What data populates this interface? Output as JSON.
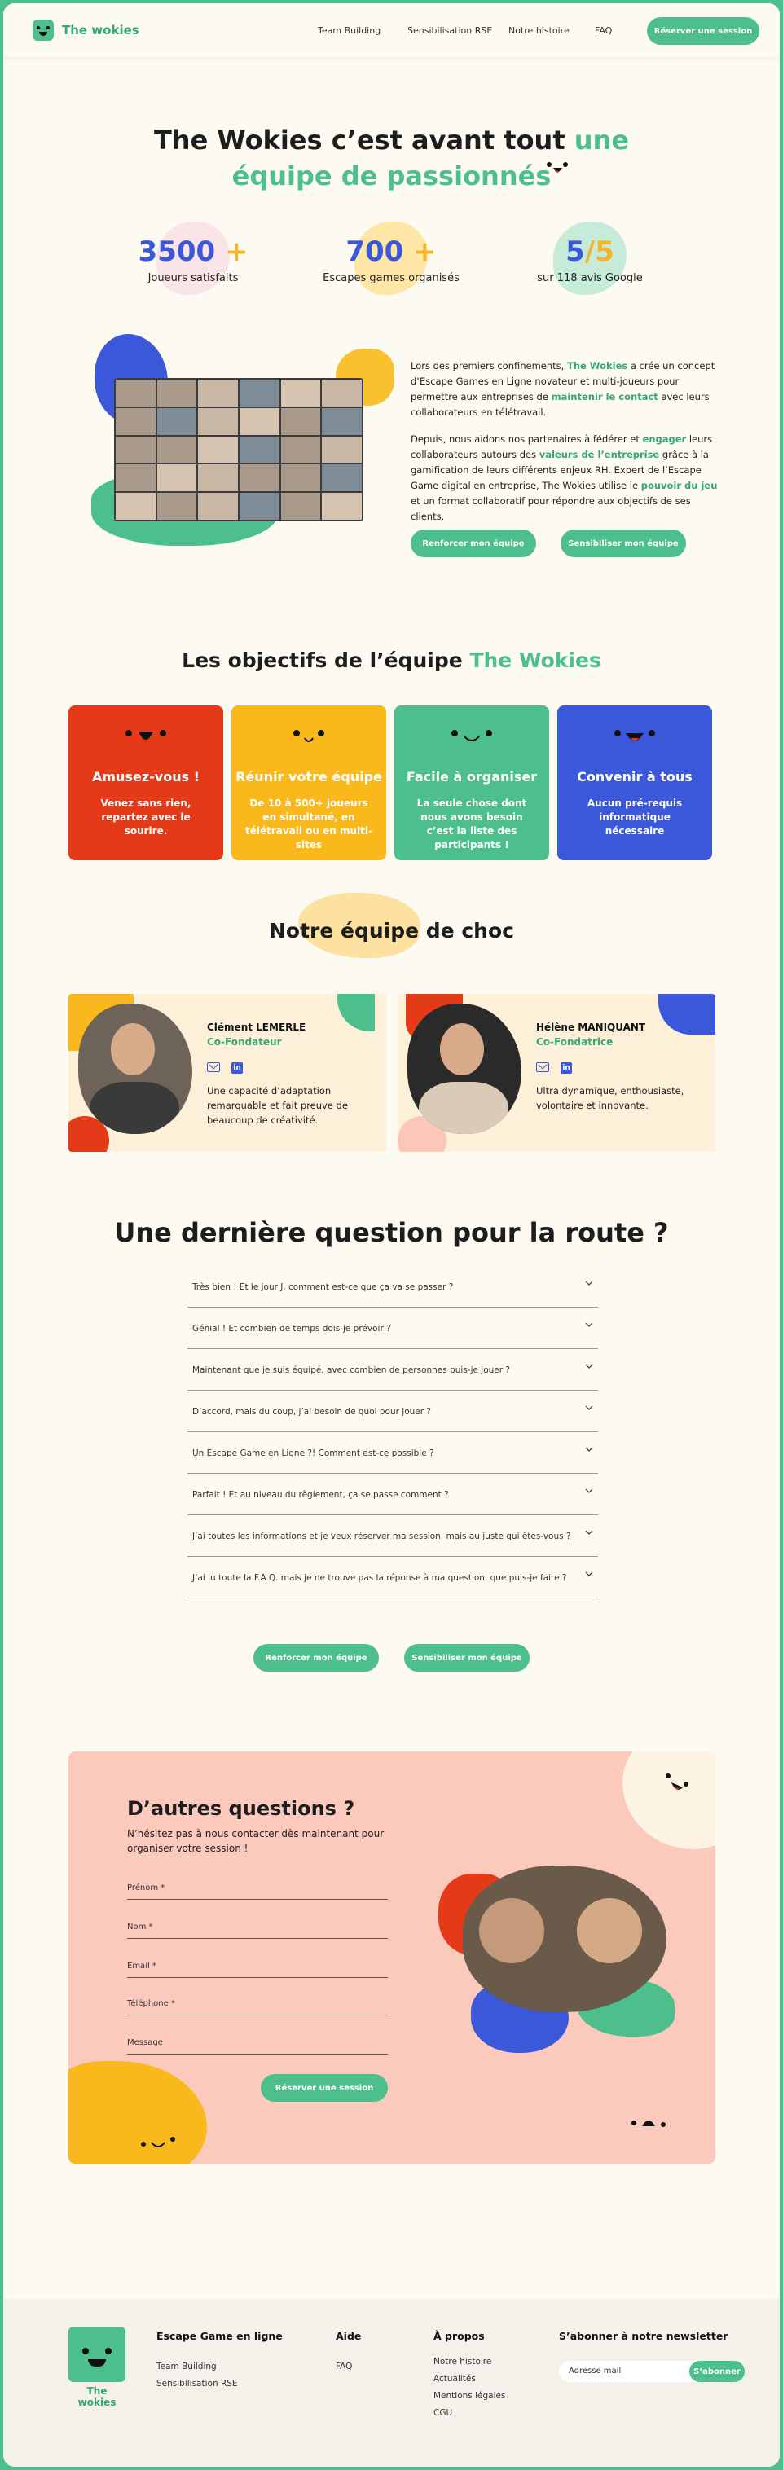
{
  "header": {
    "brand": "The wokies",
    "nav": [
      "Team Building",
      "Sensibilisation RSE",
      "Notre histoire",
      "FAQ"
    ],
    "cta": "Réserver une session"
  },
  "hero": {
    "title_part1": "The Wokies c’est avant tout",
    "title_accent1": "une",
    "title_accent2": "équipe de passionnés"
  },
  "stats": [
    {
      "value": "3500",
      "suffix": "+",
      "label": "Joueurs satisfaits"
    },
    {
      "value": "700",
      "suffix": "+",
      "label": "Escapes games organisés"
    },
    {
      "value": "5",
      "suffix": "/5",
      "label": "sur 118 avis Google"
    }
  ],
  "intro": {
    "p1_a": "Lors des premiers confinements,",
    "p1_brand": "The Wokies",
    "p1_b": "a crée un concept d’Escape Games en Ligne novateur et multi-joueurs pour permettre aux entreprises de",
    "p1_accent": "maintenir le contact",
    "p1_c": "avec leurs collaborateurs en télétravail.",
    "p2_a": "Depuis, nous aidons nos partenaires à fédérer et",
    "p2_accent1": "engager",
    "p2_b": "leurs collaborateurs autours des",
    "p2_accent2": "valeurs de l’entreprise",
    "p2_c": "grâce à la gamification de leurs différents enjeux RH. Expert de l’Escape Game digital en entreprise, The Wokies utilise le",
    "p2_accent3": "pouvoir du jeu",
    "p2_d": "et un format collaboratif pour répondre aux objectifs de ses clients.",
    "btn1": "Renforcer mon équipe",
    "btn2": "Sensibiliser mon équipe"
  },
  "objectives": {
    "title": "Les objectifs de l’équipe",
    "title_accent": "The Wokies",
    "cards": [
      {
        "title": "Amusez-vous !",
        "desc": "Venez sans rien, repartez avec le sourire.",
        "color": "#e53a18"
      },
      {
        "title": "Réunir votre équipe",
        "desc": "De 10 à 500+ joueurs en simultané, en télétravail ou en multi-sites",
        "color": "#f9b81b"
      },
      {
        "title": "Facile à organiser",
        "desc": "La seule chose dont nous avons besoin c’est la liste des participants !",
        "color": "#4cbf8d"
      },
      {
        "title": "Convenir à tous",
        "desc": "Aucun pré-requis informatique nécessaire",
        "color": "#3a58d9"
      }
    ]
  },
  "team": {
    "title": "Notre équipe de choc",
    "members": [
      {
        "name": "Clément LEMERLE",
        "role": "Co-Fondateur",
        "desc": "Une capacité d’adaptation remarquable et fait preuve de beaucoup de créativité."
      },
      {
        "name": "Hélène MANIQUANT",
        "role": "Co-Fondatrice",
        "desc": "Ultra dynamique, enthousiaste, volontaire et innovante."
      }
    ]
  },
  "faq": {
    "title": "Une dernière question pour la route ?",
    "items": [
      "Très bien ! Et le jour J, comment est-ce que ça va se passer ?",
      "Génial ! Et combien de temps dois-je prévoir ?",
      "Maintenant que je suis équipé, avec combien de personnes puis-je jouer ?",
      "D’accord, mais du coup, j’ai besoin de quoi pour jouer ?",
      "Un Escape Game en Ligne ?! Comment est-ce possible ?",
      "Parfait ! Et au niveau du règlement, ça se passe comment ?",
      "J’ai toutes les informations et je veux réserver ma session, mais au juste qui êtes-vous ?",
      "J’ai lu toute la F.A.Q. mais je ne trouve pas la réponse à ma question, que puis-je faire ?"
    ],
    "btn1": "Renforcer mon équipe",
    "btn2": "Sensibiliser mon équipe"
  },
  "contact": {
    "title": "D’autres questions ?",
    "subtitle": "N’hésitez pas à nous contacter dès maintenant pour organiser votre session !",
    "fields": [
      "Prénom *",
      "Nom *",
      "Email *",
      "Téléphone *",
      "Message"
    ],
    "submit": "Réserver une session"
  },
  "footer": {
    "brand": "The wokies",
    "col1": {
      "title": "Escape Game en ligne",
      "links": [
        "Team Building",
        "Sensibilisation RSE"
      ]
    },
    "col2": {
      "title": "Aide",
      "links": [
        "FAQ"
      ]
    },
    "col3": {
      "title": "À propos",
      "links": [
        "Notre histoire",
        "Actualités",
        "Mentions légales",
        "CGU"
      ]
    },
    "newsletter": {
      "title": "S’abonner à notre newsletter",
      "placeholder": "Adresse mail",
      "button": "S’abonner"
    }
  },
  "colors": {
    "green": "#4cbf8d",
    "blue": "#3a58d9",
    "yellow": "#f9b81b",
    "red": "#e53a18",
    "pink": "#fccabd"
  }
}
